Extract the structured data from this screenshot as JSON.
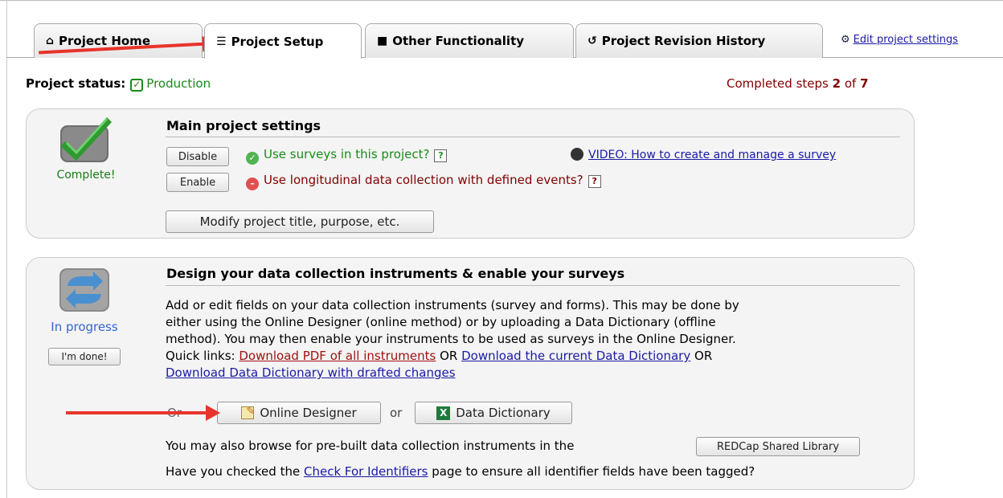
{
  "tabs": [
    {
      "label": "Project Home",
      "icon": "home-icon"
    },
    {
      "label": "Project Setup",
      "icon": "list-icon"
    },
    {
      "label": "Other Functionality",
      "icon": "square-icon"
    },
    {
      "label": "Project Revision History",
      "icon": "history-icon"
    }
  ],
  "edit_settings": "Edit project settings",
  "status": {
    "label": "Project status:",
    "value": "Production"
  },
  "completed": {
    "prefix": "Completed steps",
    "done": "2",
    "of": "of",
    "total": "7"
  },
  "panel1": {
    "side_label": "Complete!",
    "heading": "Main project settings",
    "row1": {
      "button": "Disable",
      "text": "Use surveys in this project?"
    },
    "row2": {
      "button": "Enable",
      "text": "Use longitudinal data collection with defined events?"
    },
    "help": "?",
    "video_link": "VIDEO: How to create and manage a survey",
    "modify_button": "Modify project title, purpose, etc."
  },
  "panel2": {
    "side_label": "In progress",
    "done_button": "I'm done!",
    "heading": "Design your data collection instruments & enable your surveys",
    "para_line1": "Add or edit fields on your data collection instruments (survey and forms). This may be done by",
    "para_line2": "either using the Online Designer (online method) or by uploading a Data Dictionary (offline",
    "para_line3": "method). You may then enable your instruments to be used as surveys in the Online Designer.",
    "quick_links_label": "Quick links:",
    "link_pdf": "Download PDF of all instruments",
    "or1": "OR",
    "link_dd": "Download the current Data Dictionary",
    "or2": "OR",
    "link_drafted": "Download Data Dictionary with drafted changes",
    "use_label": "Or",
    "online_designer": "Online Designer",
    "or3": "or",
    "data_dictionary": "Data Dictionary",
    "library_text": "You may also browse for pre-built data collection instruments in the",
    "library_button": "REDCap Shared Library",
    "identifiers_pre": "Have you checked the",
    "identifiers_link": "Check For Identifiers",
    "identifiers_post": "page to ensure all identifier fields have been tagged?"
  }
}
